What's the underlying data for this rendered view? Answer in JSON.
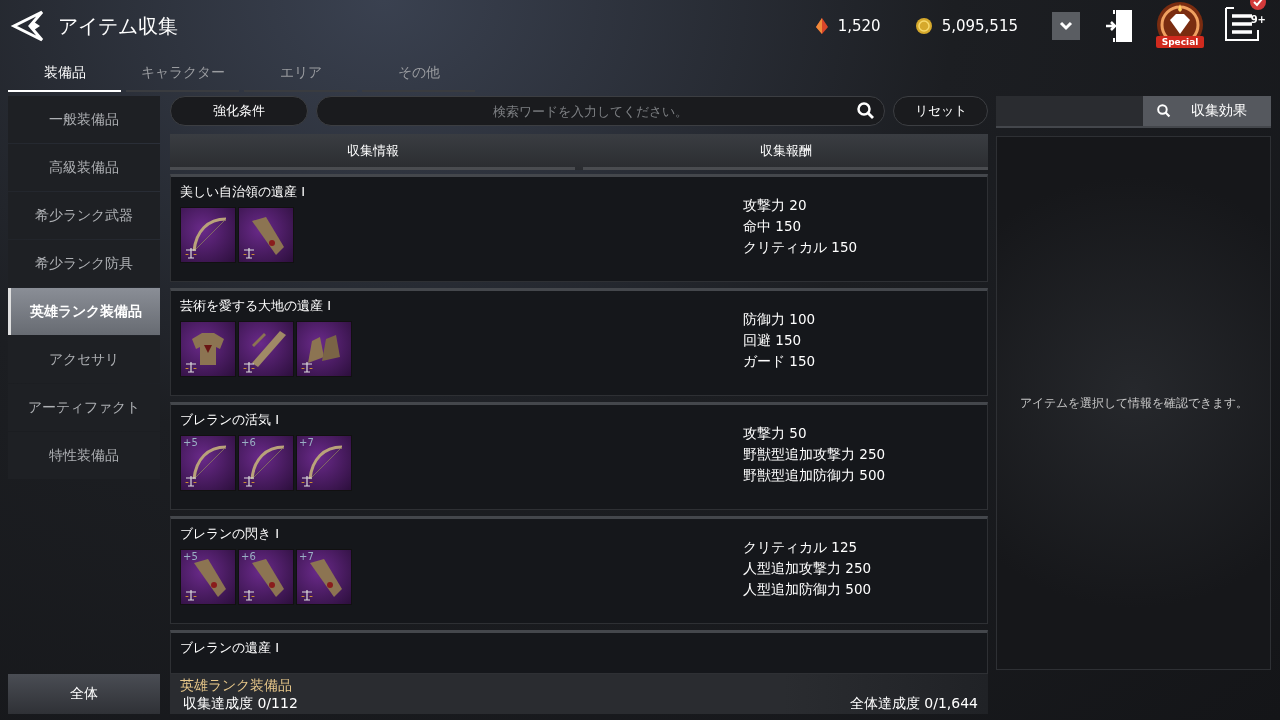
{
  "header": {
    "title": "アイテム収集",
    "currencies": [
      {
        "kind": "gem",
        "amount": "1,520"
      },
      {
        "kind": "coin",
        "amount": "5,095,515"
      }
    ],
    "special_badge": "Special",
    "menu_badge": "9+"
  },
  "tabs": [
    {
      "label": "装備品",
      "selected": true
    },
    {
      "label": "キャラクター",
      "selected": false
    },
    {
      "label": "エリア",
      "selected": false
    },
    {
      "label": "その他",
      "selected": false
    }
  ],
  "sidebar": {
    "items": [
      {
        "label": "一般装備品",
        "selected": false
      },
      {
        "label": "高級装備品",
        "selected": false
      },
      {
        "label": "希少ランク武器",
        "selected": false
      },
      {
        "label": "希少ランク防具",
        "selected": false
      },
      {
        "label": "英雄ランク装備品",
        "selected": true
      },
      {
        "label": "アクセサリ",
        "selected": false
      },
      {
        "label": "アーティファクト",
        "selected": false
      },
      {
        "label": "特性装備品",
        "selected": false
      }
    ],
    "all_button": "全体"
  },
  "toolbar": {
    "filter_button": "強化条件",
    "search": {
      "placeholder": "検索ワードを入力してください。"
    },
    "reset_button": "リセット"
  },
  "table": {
    "columns": [
      "収集情報",
      "収集報酬"
    ],
    "rows": [
      {
        "name": "美しい自治領の遺産 I",
        "items": [
          {
            "kind": "bow"
          },
          {
            "kind": "bracer"
          }
        ],
        "rewards": [
          "攻撃力 20",
          "命中 150",
          "クリティカル 150"
        ]
      },
      {
        "name": "芸術を愛する大地の遺産 I",
        "items": [
          {
            "kind": "armor"
          },
          {
            "kind": "arm-guard"
          },
          {
            "kind": "gloves"
          }
        ],
        "rewards": [
          "防御力 100",
          "回避 150",
          "ガード 150"
        ]
      },
      {
        "name": "ブレランの活気 I",
        "items": [
          {
            "kind": "bow",
            "enhance": "+5"
          },
          {
            "kind": "bow",
            "enhance": "+6"
          },
          {
            "kind": "bow",
            "enhance": "+7"
          }
        ],
        "rewards": [
          "攻撃力 50",
          "野獣型追加攻撃力 250",
          "野獣型追加防御力 500"
        ]
      },
      {
        "name": "ブレランの閃き I",
        "items": [
          {
            "kind": "bracer",
            "enhance": "+5"
          },
          {
            "kind": "bracer",
            "enhance": "+6"
          },
          {
            "kind": "bracer",
            "enhance": "+7"
          }
        ],
        "rewards": [
          "クリティカル 125",
          "人型追加攻撃力 250",
          "人型追加防御力 500"
        ]
      },
      {
        "name": "ブレランの遺産 I",
        "items": [],
        "rewards": []
      }
    ]
  },
  "detail": {
    "effects_button": "収集効果",
    "message": "アイテムを選択して情報を確認できます。"
  },
  "footer": {
    "category": "英雄ランク装備品",
    "progress": "収集達成度 0/112",
    "total": "全体達成度 0/1,644"
  }
}
